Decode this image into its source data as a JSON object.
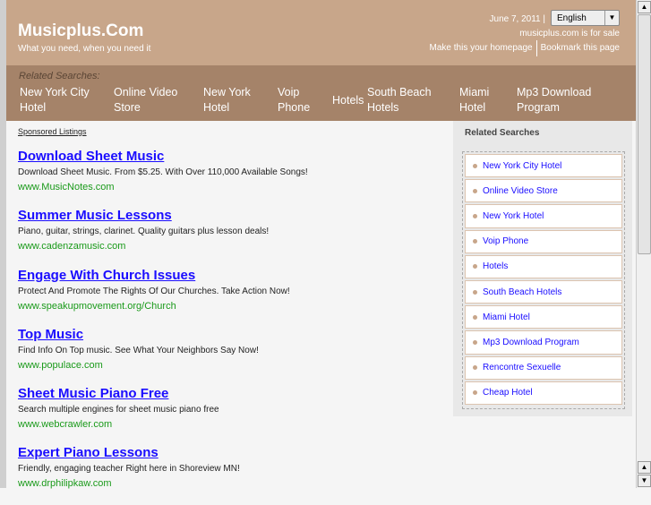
{
  "header": {
    "logo": "Musicplus.Com",
    "tagline": "What you need, when you need it",
    "date": "June 7, 2011 |",
    "language": "English",
    "for_sale": "musicplus.com is for sale",
    "homepage_link": "Make this your homepage",
    "bookmark_link": "Bookmark this page"
  },
  "nav": {
    "label": "Related Searches:",
    "items": [
      "New York City Hotel",
      "Online Video Store",
      "New York Hotel",
      "Voip Phone",
      "Hotels",
      "South Beach Hotels",
      "Miami Hotel",
      "Mp3 Download Program"
    ]
  },
  "main": {
    "sponsored": "Sponsored Listings",
    "ads": [
      {
        "title": "Download Sheet Music",
        "desc": "Download Sheet Music. From $5.25. With Over 110,000 Available Songs!",
        "url": "www.MusicNotes.com"
      },
      {
        "title": "Summer Music Lessons",
        "desc": "Piano, guitar, strings, clarinet. Quality guitars plus lesson deals!",
        "url": "www.cadenzamusic.com"
      },
      {
        "title": "Engage With Church Issues",
        "desc": "Protect And Promote The Rights Of Our Churches. Take Action Now!",
        "url": "www.speakupmovement.org/Church"
      },
      {
        "title": "Top Music",
        "desc": "Find Info On Top music. See What Your Neighbors Say Now!",
        "url": "www.populace.com"
      },
      {
        "title": "Sheet Music Piano Free",
        "desc": "Search multiple engines for sheet music piano free",
        "url": "www.webcrawler.com"
      },
      {
        "title": "Expert Piano Lessons",
        "desc": "Friendly, engaging teacher Right here in Shoreview MN!",
        "url": "www.drphilipkaw.com"
      }
    ]
  },
  "sidebar": {
    "title": "Related Searches",
    "items": [
      "New York City Hotel",
      "Online Video Store",
      "New York Hotel",
      "Voip Phone",
      "Hotels",
      "South Beach Hotels",
      "Miami Hotel",
      "Mp3 Download Program",
      "Rencontre Sexuelle",
      "Cheap Hotel"
    ]
  }
}
